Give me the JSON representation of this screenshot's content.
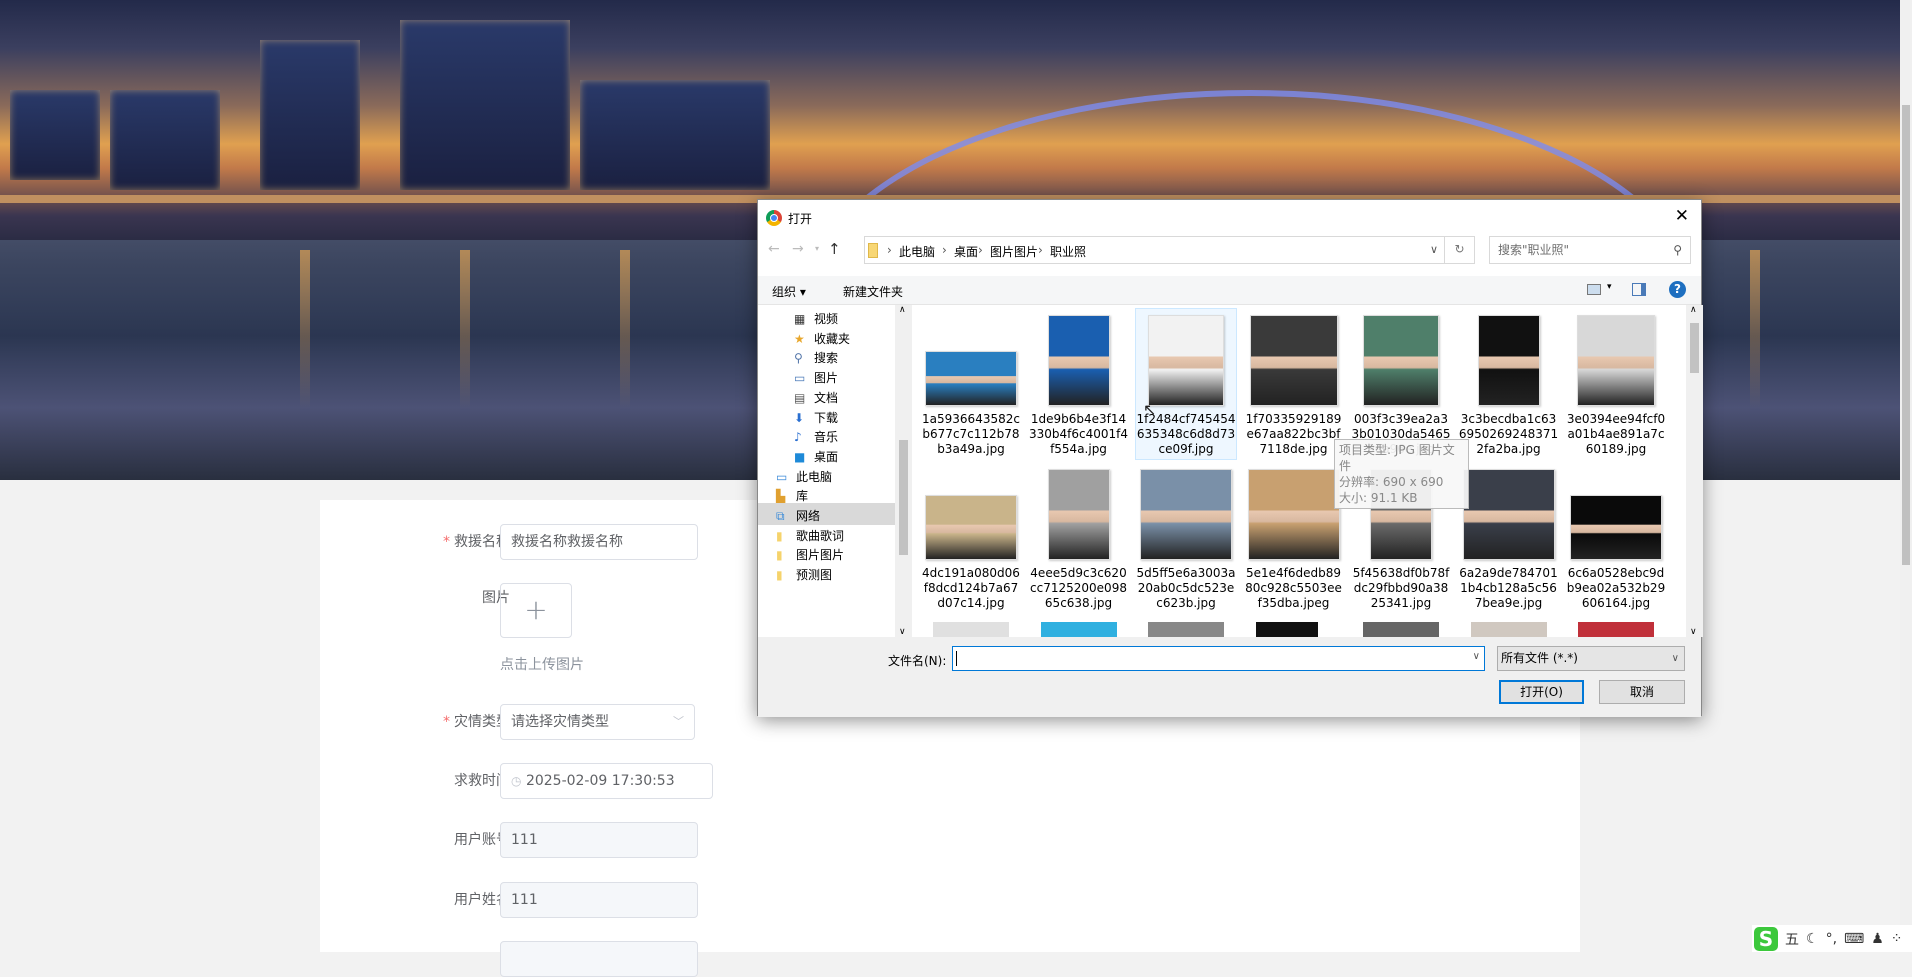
{
  "form": {
    "name_label": "救援名称",
    "name_value": "救援名称救援名称",
    "image_label": "图片",
    "upload_hint": "点击上传图片",
    "type_label": "灾情类型",
    "type_placeholder": "请选择灾情类型",
    "time_label": "求救时间",
    "time_value": "2025-02-09 17:30:53",
    "account_label": "用户账号",
    "account_value": "111",
    "username_label": "用户姓名",
    "username_value": "111",
    "required_mark": "*"
  },
  "dialog": {
    "title": "打开",
    "breadcrumb": [
      "此电脑",
      "桌面",
      "图片图片",
      "职业照"
    ],
    "search_placeholder": "搜索\"职业照\"",
    "organize": "组织 ▾",
    "new_folder": "新建文件夹",
    "nav_items": [
      "视频",
      "收藏夹",
      "搜索",
      "图片",
      "文档",
      "下载",
      "音乐",
      "桌面",
      "此电脑",
      "库",
      "网络",
      "歌曲歌词",
      "图片图片",
      "预测图"
    ],
    "files": [
      {
        "name": "1a5936643582cb677c7c112b78b3a49a.jpg",
        "color": "#2a7fc0"
      },
      {
        "name": "1de9b6b4e3f14330b4f6c4001f4f554a.jpg",
        "color": "#1a5fb0"
      },
      {
        "name": "1f2484cf745454635348c6d8d73ce09f.jpg",
        "color": "#f2f2f2"
      },
      {
        "name": "1f70335929189e67aa822bc3bf7118de.jpg",
        "color": "#3a3a3a"
      },
      {
        "name": "003f3c39ea2a33b01030da54659ea96e.jpg",
        "color": "#4f7f6a"
      },
      {
        "name": "3c3becdba1c636950269248371 2fa2ba.jpg",
        "color": "#111111"
      },
      {
        "name": "3e0394ee94fcf0a01b4ae891a7c60189.jpg",
        "color": "#d8d8d8"
      },
      {
        "name": "4dc191a080d06f8dcd124b7a67d07c14.jpg",
        "color": "#c9b48a"
      },
      {
        "name": "4eee5d9c3c620cc7125200e09865c638.jpg",
        "color": "#a0a0a0"
      },
      {
        "name": "5d5ff5e6a3003a20ab0c5dc523ec623b.jpg",
        "color": "#7a90a8"
      },
      {
        "name": "5e1e4f6dedb8980c928c5503eef35dba.jpeg",
        "color": "#c8a070"
      },
      {
        "name": "5f45638df0b78fdc29fbbd90a3825341.jpg",
        "color": "#6a6a6a"
      },
      {
        "name": "6a2a9de7847011b4cb128a5c567bea9e.jpg",
        "color": "#3a3f4a"
      },
      {
        "name": "6c6a0528ebc9db9ea02a532b29606164.jpg",
        "color": "#0a0a0a"
      }
    ],
    "partial_colors": [
      "#e0e0e0",
      "#30b0e0",
      "#888888",
      "#111111",
      "#666666",
      "#d0c8c0",
      "#c0303a"
    ],
    "tooltip": [
      "项目类型: JPG 图片文件",
      "分辨率: 690 x 690",
      "大小: 91.1 KB"
    ],
    "filename_label": "文件名(N):",
    "filename_value": "",
    "filetype": "所有文件 (*.*)",
    "open_btn": "打开(O)",
    "cancel_btn": "取消"
  },
  "ime": {
    "mode": "五",
    "punct": "°,"
  }
}
